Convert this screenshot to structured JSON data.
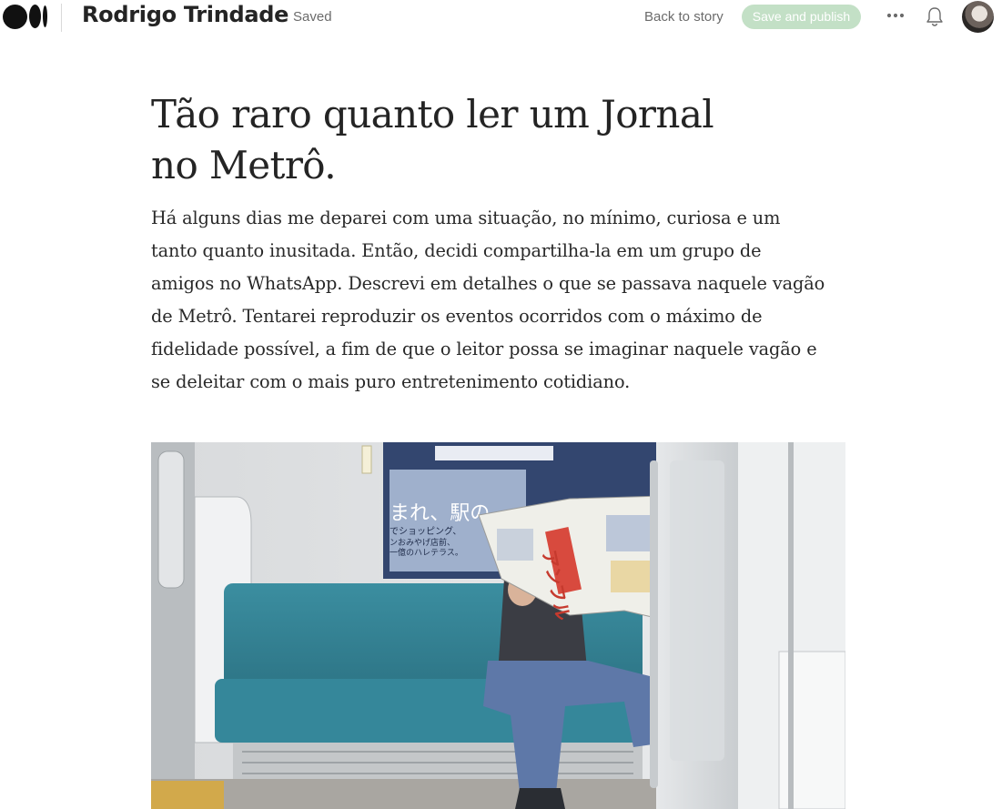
{
  "header": {
    "author_name": "Rodrigo Trindade",
    "status": "Saved",
    "back_link": "Back to story",
    "publish_button": "Save and publish",
    "icons": {
      "logo": "medium-logo",
      "more": "more-horizontal-icon",
      "notifications": "bell-icon",
      "avatar": "user-avatar"
    },
    "publish_button_color": "#c3e0c6"
  },
  "article": {
    "title_lines": [
      "Tão raro quanto ler um Jornal",
      "no Metrô."
    ],
    "paragraph_lines": [
      "Há alguns dias me deparei com uma situação, no mínimo, curiosa e um",
      "tanto quanto inusitada. Então, decidi compartilha-la em um grupo de",
      "amigos no WhatsApp. Descrevi em detalhes o que se passava naquele vagão",
      "de Metrô. Tentarei reproduzir os eventos ocorridos com o máximo de",
      "fidelidade possível, a fim de que o leitor possa se imaginar naquele vagão e",
      "se deleitar com o mais puro entretenimento cotidiano."
    ]
  },
  "image": {
    "icon": "subway-newspaper-photo",
    "poster_lines": [
      "まれ、駅の",
      "でショッピング、",
      "ンおみやげ店前、",
      "一億のハレテラス。"
    ],
    "newspaper_text": "アンフル"
  }
}
